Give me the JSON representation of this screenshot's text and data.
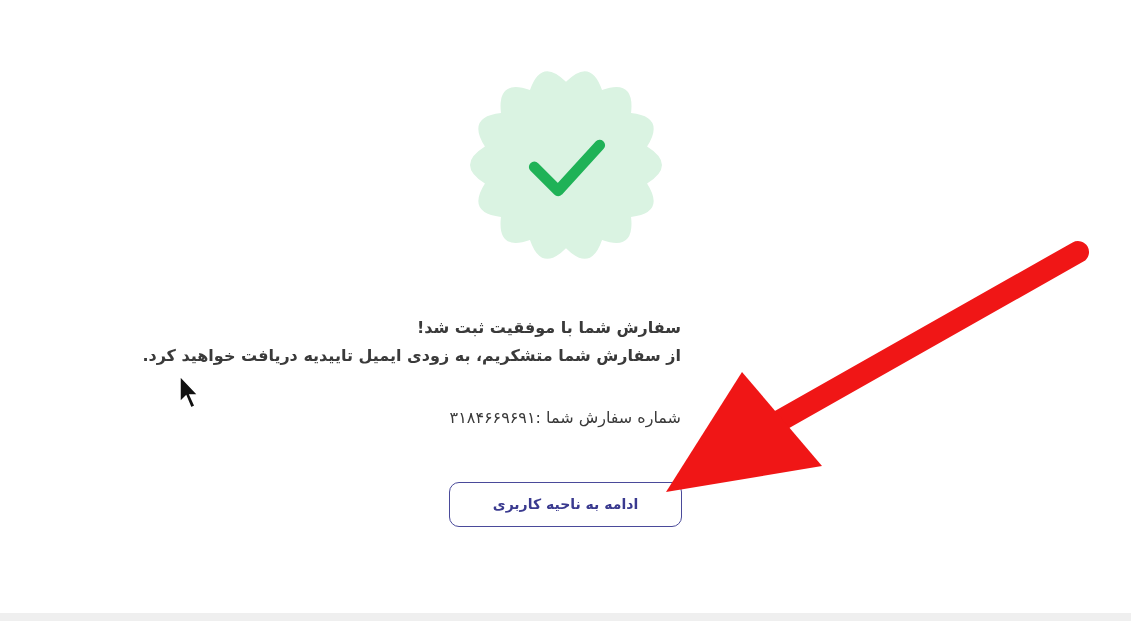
{
  "message": {
    "title": "سفارش شما با موفقیت ثبت شد!",
    "body": "از سفارش شما متشکریم، به زودی ایمیل تاییدیه دریافت خواهید کرد.",
    "order_number": "شماره سفارش شما :۳۱۸۴۶۶۹۶۹۱"
  },
  "button": {
    "label": "ادامه به ناحیه کاربری"
  }
}
